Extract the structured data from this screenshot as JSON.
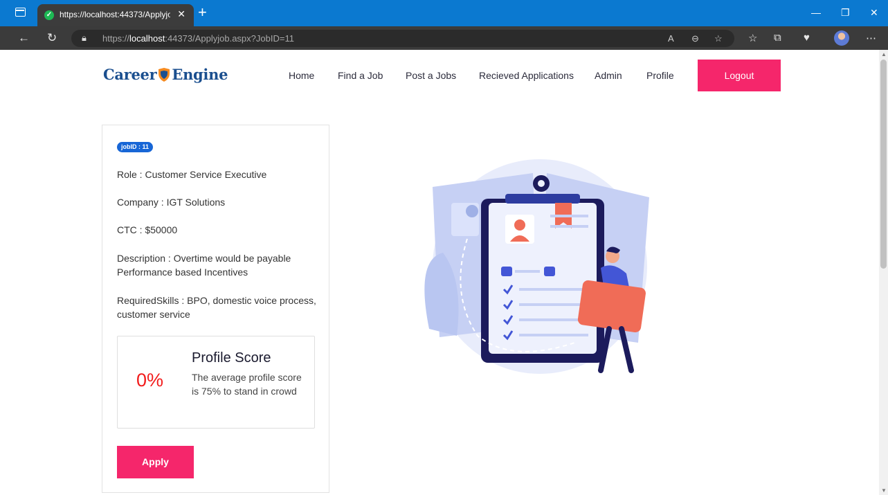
{
  "browser": {
    "tab_title": "https://localhost:44373/Applyjob.aspx?JobID=11",
    "url_prefix": "https://",
    "url_host": "localhost",
    "url_rest": ":44373/Applyjob.aspx?JobID=11",
    "icons": [
      "window-icon",
      "favicon-check-icon",
      "close-tab-icon",
      "new-tab-icon",
      "minimize-icon",
      "restore-icon",
      "close-window-icon",
      "back-icon",
      "refresh-icon",
      "lock-icon",
      "read-aloud-icon",
      "zoom-out-icon",
      "add-favorite-icon",
      "favorites-icon",
      "collections-icon",
      "health-icon",
      "profile-avatar",
      "more-icon"
    ]
  },
  "site": {
    "logo_part1": "Career",
    "logo_part2": "Engine",
    "nav": [
      "Home",
      "Find a Job",
      "Post a Jobs",
      "Recieved Applications",
      "Admin",
      "Profile"
    ],
    "logout_label": "Logout"
  },
  "job": {
    "badge": "jobID : 11",
    "role": "Role : Customer Service Executive",
    "company": "Company : IGT Solutions",
    "ctc": "CTC : $50000",
    "description_line1": "Description : Overtime would be payable",
    "description_line2": "Performance based Incentives",
    "skills": "RequiredSkills : BPO, domestic voice process, customer service"
  },
  "profile_score": {
    "value": "0%",
    "title": "Profile Score",
    "text": "The average profile score is 75% to stand in crowd"
  },
  "apply_label": "Apply",
  "colors": {
    "accent": "#f5266b",
    "titlebar": "#0b79d0",
    "badge": "#1766d6",
    "score": "#f21c1c"
  }
}
